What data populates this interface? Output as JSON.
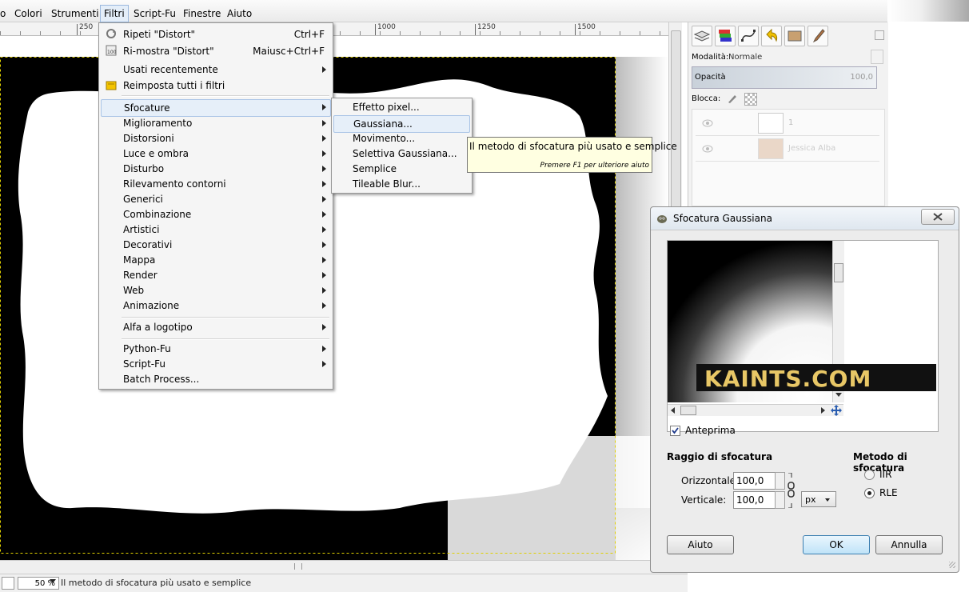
{
  "menubar": {
    "items": [
      "o",
      "Colori",
      "Strumenti",
      "Filtri",
      "Script-Fu",
      "Finestre",
      "Aiuto"
    ]
  },
  "ruler": {
    "labels": [
      "250",
      "1000",
      "1250",
      "1500"
    ]
  },
  "filters_menu": {
    "repeat_label": "Ripeti \"Distort\"",
    "repeat_shortcut": "Ctrl+F",
    "reshow_label": "Ri-mostra \"Distort\"",
    "reshow_shortcut": "Maiusc+Ctrl+F",
    "recent_label": "Usati recentemente",
    "reset_label": "Reimposta tutti i filtri",
    "categories": [
      "Sfocature",
      "Miglioramento",
      "Distorsioni",
      "Luce e ombra",
      "Disturbo",
      "Rilevamento contorni",
      "Generici",
      "Combinazione",
      "Artistici",
      "Decorativi",
      "Mappa",
      "Render",
      "Web",
      "Animazione"
    ],
    "alpha_label": "Alfa a logotipo",
    "python_label": "Python-Fu",
    "scriptfu_label": "Script-Fu",
    "batch_label": "Batch Process..."
  },
  "blur_submenu": {
    "items": [
      "Effetto pixel...",
      "Gaussiana...",
      "Movimento...",
      "Selettiva Gaussiana...",
      "Semplice",
      "Tileable Blur..."
    ]
  },
  "tooltip": {
    "text": "Il metodo di sfocatura più usato e semplice",
    "hint": "Premere F1 per ulteriore aiuto"
  },
  "dock": {
    "mode_label": "Modalità:",
    "mode_value": "Normale",
    "opacity_label": "Opacità",
    "opacity_value": "100,0",
    "lock_label": "Blocca:",
    "layers": [
      "1",
      "Jessica Alba"
    ]
  },
  "dialog": {
    "title": "Sfocatura Gaussiana",
    "preview_label": "Anteprima",
    "radius_header": "Raggio di sfocatura",
    "horizontal_label": "Orizzontale:",
    "horizontal_value": "100,0",
    "vertical_label": "Verticale:",
    "vertical_value": "100,0",
    "unit": "px",
    "method_header": "Metodo di sfocatura",
    "method_options": [
      "IIR",
      "RLE"
    ],
    "method_selected": "RLE",
    "help_button": "Aiuto",
    "ok_button": "OK",
    "cancel_button": "Annulla",
    "watermark": "KAINTS.COM"
  },
  "status": {
    "zoom": "50 %",
    "message": "Il metodo di sfocatura più usato e semplice"
  },
  "colors": {
    "accent": "#3399ff",
    "menu_highlight": "#e6eff9",
    "tooltip_bg": "#ffffe1"
  }
}
